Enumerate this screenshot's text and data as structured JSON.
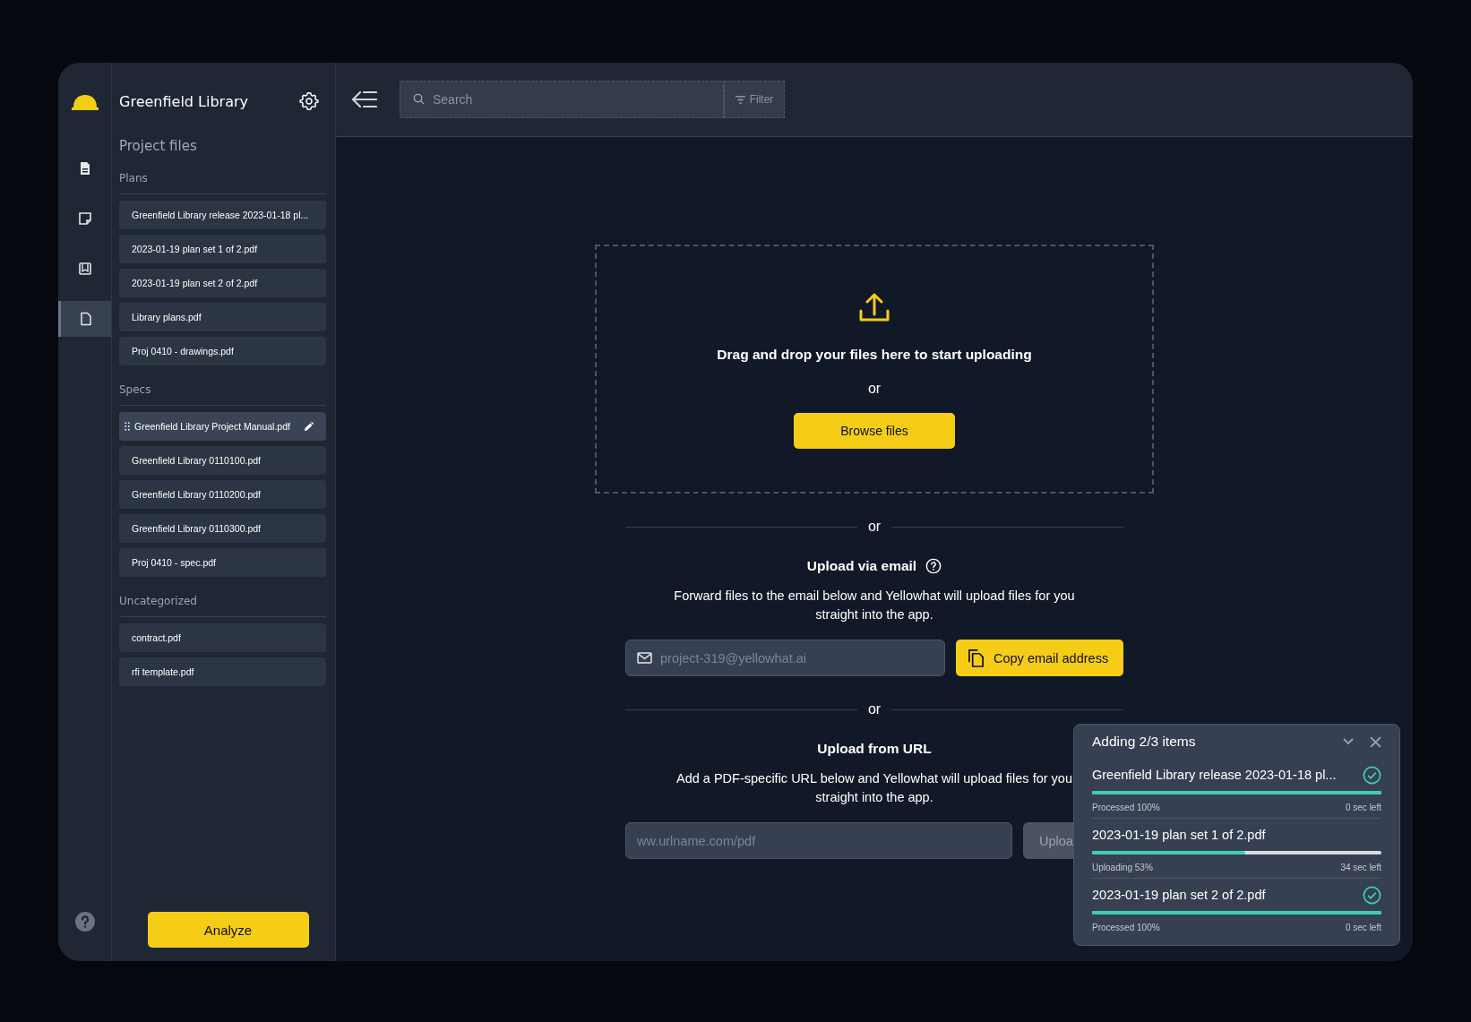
{
  "app": {
    "title": "Greenfield Library"
  },
  "rail": {
    "items": [
      {
        "kind": "document",
        "selected": false
      },
      {
        "kind": "note",
        "selected": false
      },
      {
        "kind": "book",
        "selected": false
      },
      {
        "kind": "file",
        "selected": true
      }
    ]
  },
  "sidebar": {
    "heading": "Project files",
    "groups": [
      {
        "title": "Plans",
        "files": [
          {
            "name": "Greenfield Library release 2023-01-18 pl...",
            "selected": false
          },
          {
            "name": "2023-01-19 plan set 1 of 2.pdf",
            "selected": false
          },
          {
            "name": "2023-01-19 plan set 2 of 2.pdf",
            "selected": false
          },
          {
            "name": "Library plans.pdf",
            "selected": false
          },
          {
            "name": "Proj 0410 - drawings.pdf",
            "selected": false
          }
        ]
      },
      {
        "title": "Specs",
        "files": [
          {
            "name": "Greenfield Library Project Manual.pdf",
            "selected": true
          },
          {
            "name": "Greenfield Library 0110100.pdf",
            "selected": false
          },
          {
            "name": "Greenfield Library 0110200.pdf",
            "selected": false
          },
          {
            "name": "Greenfield Library 0110300.pdf",
            "selected": false
          },
          {
            "name": "Proj 0410 - spec.pdf",
            "selected": false
          }
        ]
      },
      {
        "title": "Uncategorized",
        "files": [
          {
            "name": "contract.pdf",
            "selected": false
          },
          {
            "name": "rfi template.pdf",
            "selected": false
          }
        ]
      }
    ],
    "analyze_button": "Analyze"
  },
  "toolbar": {
    "search": {
      "placeholder": "Search"
    },
    "filter": "Filter"
  },
  "dropzone": {
    "title": "Drag and drop your files here to start uploading",
    "or": "or",
    "button": "Browse files"
  },
  "separators": [
    "or",
    "or"
  ],
  "email": {
    "title": "Upload via email",
    "text": "Forward files to the email below and Yellowhat will upload files for you straight into the app.",
    "placeholder": "project-319@yellowhat.ai",
    "button": "Copy email address"
  },
  "url": {
    "title": "Upload from URL",
    "text": "Add a PDF-specific URL below and Yellowhat will upload files for you straight into the app.",
    "placeholder": "ww.urlname.com/pdf",
    "button": "Uploa",
    "disabled": true
  },
  "upload_panel": {
    "title": "Adding 2/3 items",
    "items": [
      {
        "name": "Greenfield Library release 2023-01-18 pl...",
        "level": 1,
        "status": "Processed 100%",
        "remaining": "0 sec left",
        "done": true
      },
      {
        "name": "2023-01-19 plan set 1 of 2.pdf",
        "level": 0.53,
        "status": "Uploading 53%",
        "remaining": "34 sec left",
        "done": false
      },
      {
        "name": "2023-01-19 plan set 2 of 2.pdf",
        "level": 1,
        "status": "Processed 100%",
        "remaining": "0 sec left",
        "done": true
      }
    ]
  }
}
